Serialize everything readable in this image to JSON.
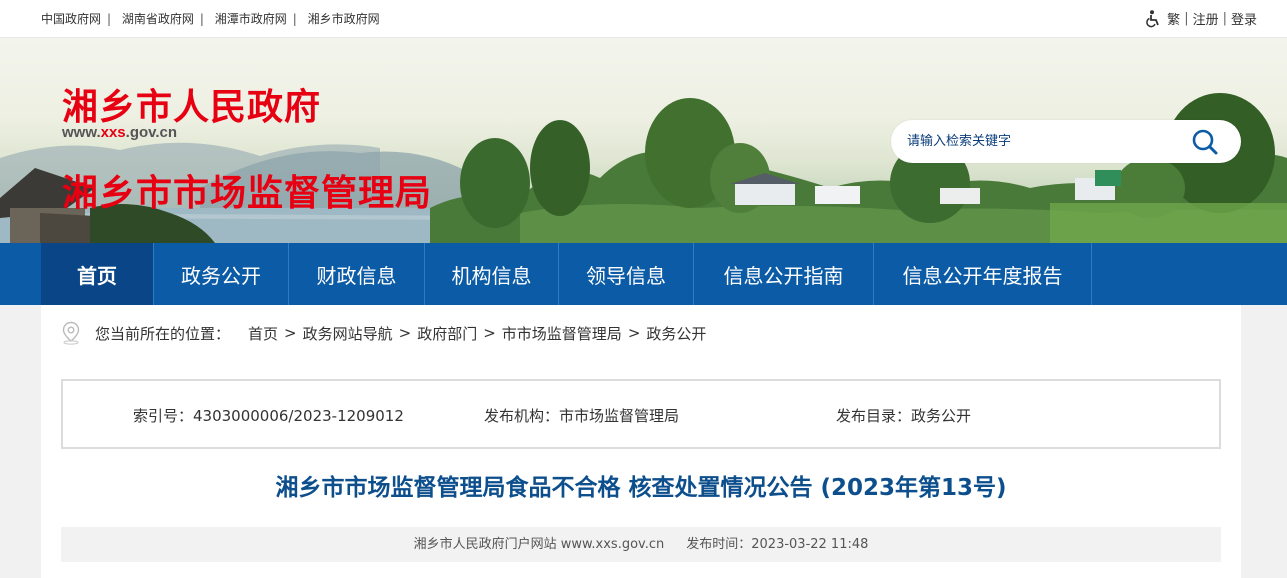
{
  "top_links": [
    "中国政府网",
    "湖南省政府网",
    "湘潭市政府网",
    "湘乡市政府网"
  ],
  "top_right": {
    "accessibility_icon": "wheelchair-icon",
    "traditional": "繁",
    "register": "注册",
    "login": "登录"
  },
  "header": {
    "site_title": "湘乡市人民政府",
    "site_url_prefix": "www.",
    "site_url_highlight": "xxs",
    "site_url_suffix": ".gov.cn",
    "dept_title": "湘乡市市场监督管理局",
    "search_placeholder": "请输入检索关键字",
    "search_icon": "search-icon"
  },
  "nav": [
    "首页",
    "政务公开",
    "财政信息",
    "机构信息",
    "领导信息",
    "信息公开指南",
    "信息公开年度报告"
  ],
  "breadcrumb": {
    "label": "您当前所在的位置：",
    "items": [
      "首页",
      "政务网站导航",
      "政府部门",
      "市市场监督管理局",
      "政务公开"
    ],
    "separator": ">"
  },
  "meta": {
    "index_no": "索引号：4303000006/2023-1209012",
    "publisher": "发布机构：市市场监督管理局",
    "catalog": "发布目录：政务公开"
  },
  "article": {
    "title": "湘乡市市场监督管理局食品不合格 核查处置情况公告 (2023年第13号)",
    "source": "湘乡市人民政府门户网站 www.xxs.gov.cn",
    "publish_time": "发布时间：2023-03-22 11:48"
  },
  "colors": {
    "nav_bg": "#0b5ba6",
    "nav_active": "#0a4687",
    "title_red": "#e60012",
    "article_title": "#0d4e8c"
  }
}
